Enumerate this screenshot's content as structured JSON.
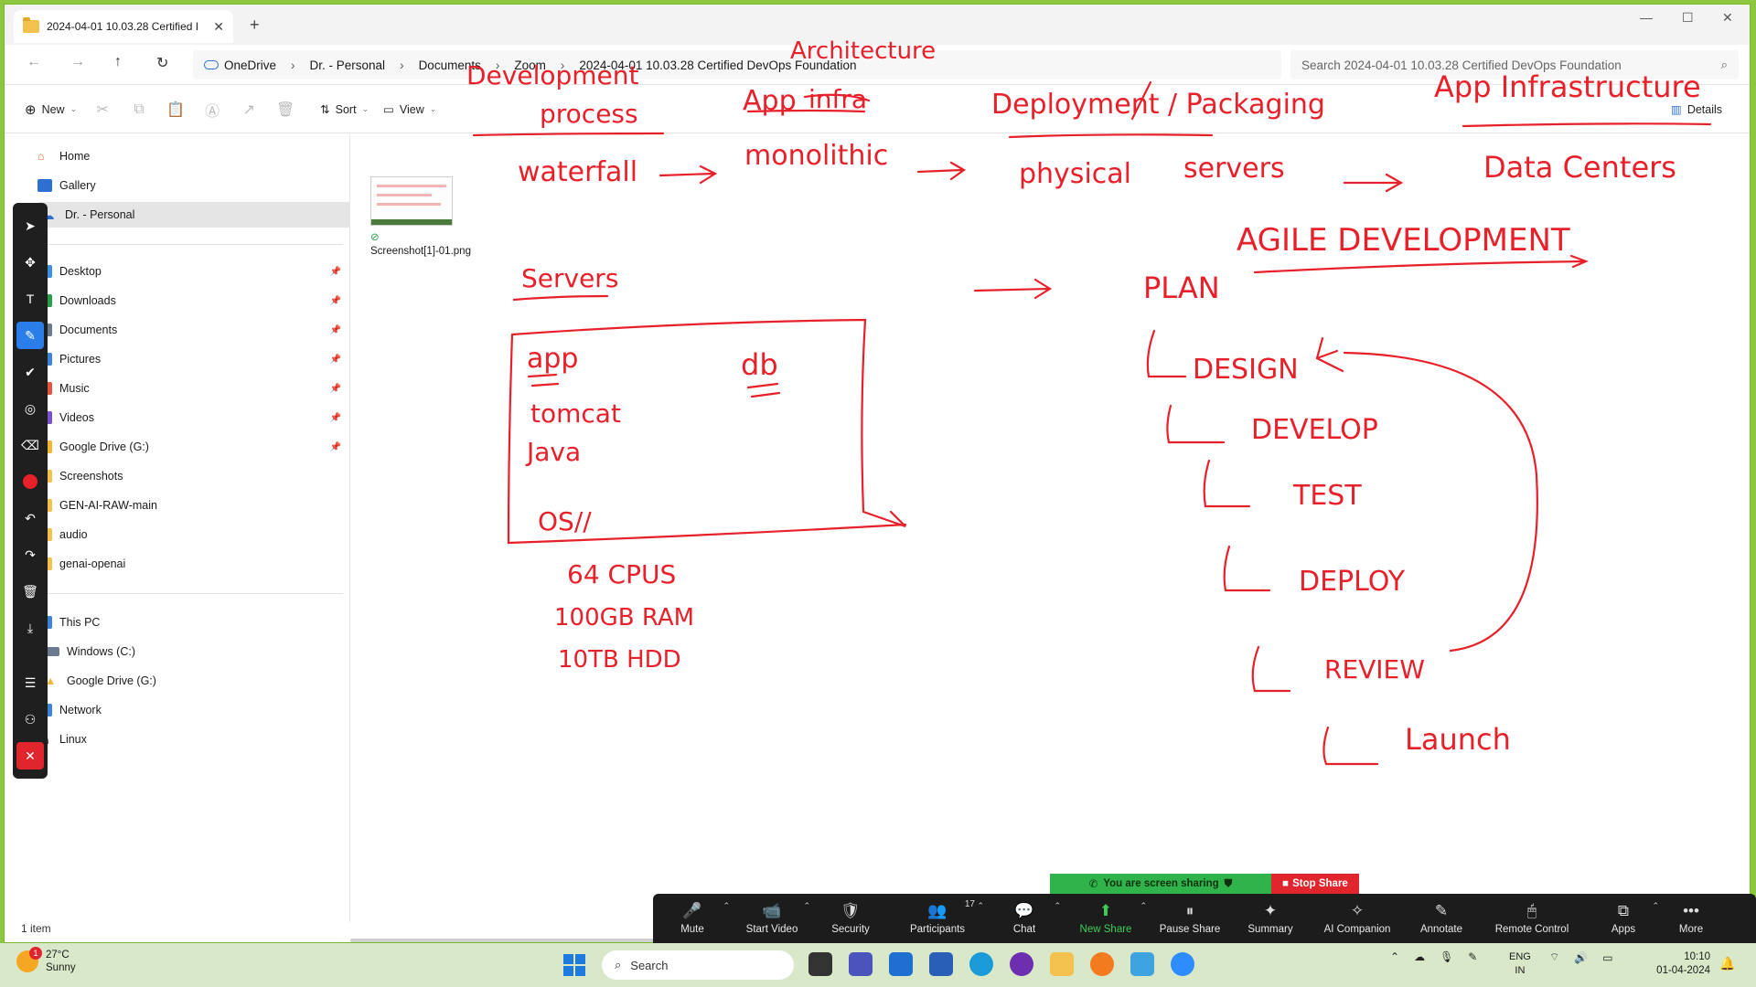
{
  "window": {
    "tab_title": "2024-04-01 10.03.28 Certified I",
    "new_tab": "+",
    "tab_close": "✕",
    "minimize": "—",
    "maximize": "☐",
    "close": "✕"
  },
  "address": {
    "breadcrumbs": [
      "OneDrive",
      "Dr. - Personal",
      "Documents",
      "Zoom",
      "2024-04-01 10.03.28 Certified DevOps Foundation"
    ],
    "search_placeholder": "Search 2024-04-01 10.03.28 Certified DevOps Foundation"
  },
  "commands": {
    "new": "New",
    "sort": "Sort",
    "view": "View",
    "details": "Details"
  },
  "nav": {
    "home": "Home",
    "gallery": "Gallery",
    "personal": "Dr. - Personal",
    "items": [
      {
        "label": "Desktop",
        "pinned": true,
        "color": "#3b8ee0"
      },
      {
        "label": "Downloads",
        "pinned": true,
        "color": "#2a9d4b"
      },
      {
        "label": "Documents",
        "pinned": true,
        "color": "#6b7a8f"
      },
      {
        "label": "Pictures",
        "pinned": true,
        "color": "#3c82d8"
      },
      {
        "label": "Music",
        "pinned": true,
        "color": "#e0553b"
      },
      {
        "label": "Videos",
        "pinned": true,
        "color": "#7a4fd0"
      },
      {
        "label": "Google Drive (G:)",
        "pinned": true,
        "color": "#f2b632"
      },
      {
        "label": "Screenshots",
        "pinned": false,
        "color": "#f2c14e"
      },
      {
        "label": "GEN-AI-RAW-main",
        "pinned": false,
        "color": "#f2c14e"
      },
      {
        "label": "audio",
        "pinned": false,
        "color": "#f2c14e"
      },
      {
        "label": "genai-openai",
        "pinned": false,
        "color": "#f2c14e"
      }
    ],
    "this_pc": "This PC",
    "windows_c": "Windows (C:)",
    "google_drive": "Google Drive (G:)",
    "network": "Network",
    "linux": "Linux"
  },
  "content": {
    "file_name": "Screenshot[1]-01.png",
    "status": "1 item"
  },
  "ink": {
    "h_dev1": "Development",
    "h_dev2": "process",
    "h_app": "App",
    "h_infra_struck": "infra",
    "h_arch": "Architecture",
    "h_deploy": "Deployment / Packaging",
    "h_appinfra": "App   Infrastructure",
    "waterfall": "waterfall",
    "monolithic": "monolithic",
    "physical": "physical",
    "servers_row": "servers",
    "datacenters": "Data Centers",
    "agile": "AGILE  DEVELOPMENT",
    "servers_title": "Servers",
    "plan": "PLAN",
    "app": "app",
    "db": "db",
    "tomcat": "tomcat",
    "java": "Java",
    "os": "OS//",
    "design": "DESIGN",
    "develop": "DEVELOP",
    "test": "TEST",
    "deploy": "DEPLOY",
    "review": "REVIEW",
    "launch": "Launch",
    "cpus": "64 CPUS",
    "ram": "100GB RAM",
    "hdd": "10TB HDD"
  },
  "zoom": {
    "sharing": "You are screen sharing",
    "stop_share": "Stop Share",
    "buttons": [
      {
        "label": "Mute",
        "icon": "🎤",
        "caret": true
      },
      {
        "label": "Start Video",
        "icon": "📹",
        "caret": true
      },
      {
        "label": "Security",
        "icon": "🛡",
        "caret": false
      },
      {
        "label": "Participants",
        "icon": "👥",
        "caret": true,
        "badge": "17"
      },
      {
        "label": "Chat",
        "icon": "💬",
        "caret": true
      },
      {
        "label": "New Share",
        "icon": "⬆",
        "caret": true,
        "green": true
      },
      {
        "label": "Pause Share",
        "icon": "⏸",
        "caret": false
      },
      {
        "label": "Summary",
        "icon": "✦",
        "caret": false
      },
      {
        "label": "AI Companion",
        "icon": "✧",
        "caret": false
      },
      {
        "label": "Annotate",
        "icon": "✎",
        "caret": false
      },
      {
        "label": "Remote Control",
        "icon": "🖱",
        "caret": false
      },
      {
        "label": "Apps",
        "icon": "⧉",
        "caret": true
      },
      {
        "label": "More",
        "icon": "•••",
        "caret": false
      }
    ]
  },
  "taskbar": {
    "temp": "27°C",
    "weather": "Sunny",
    "weather_badge": "1",
    "search": "Search",
    "lang1": "ENG",
    "lang2": "IN",
    "time": "10:10",
    "date": "01-04-2024"
  }
}
